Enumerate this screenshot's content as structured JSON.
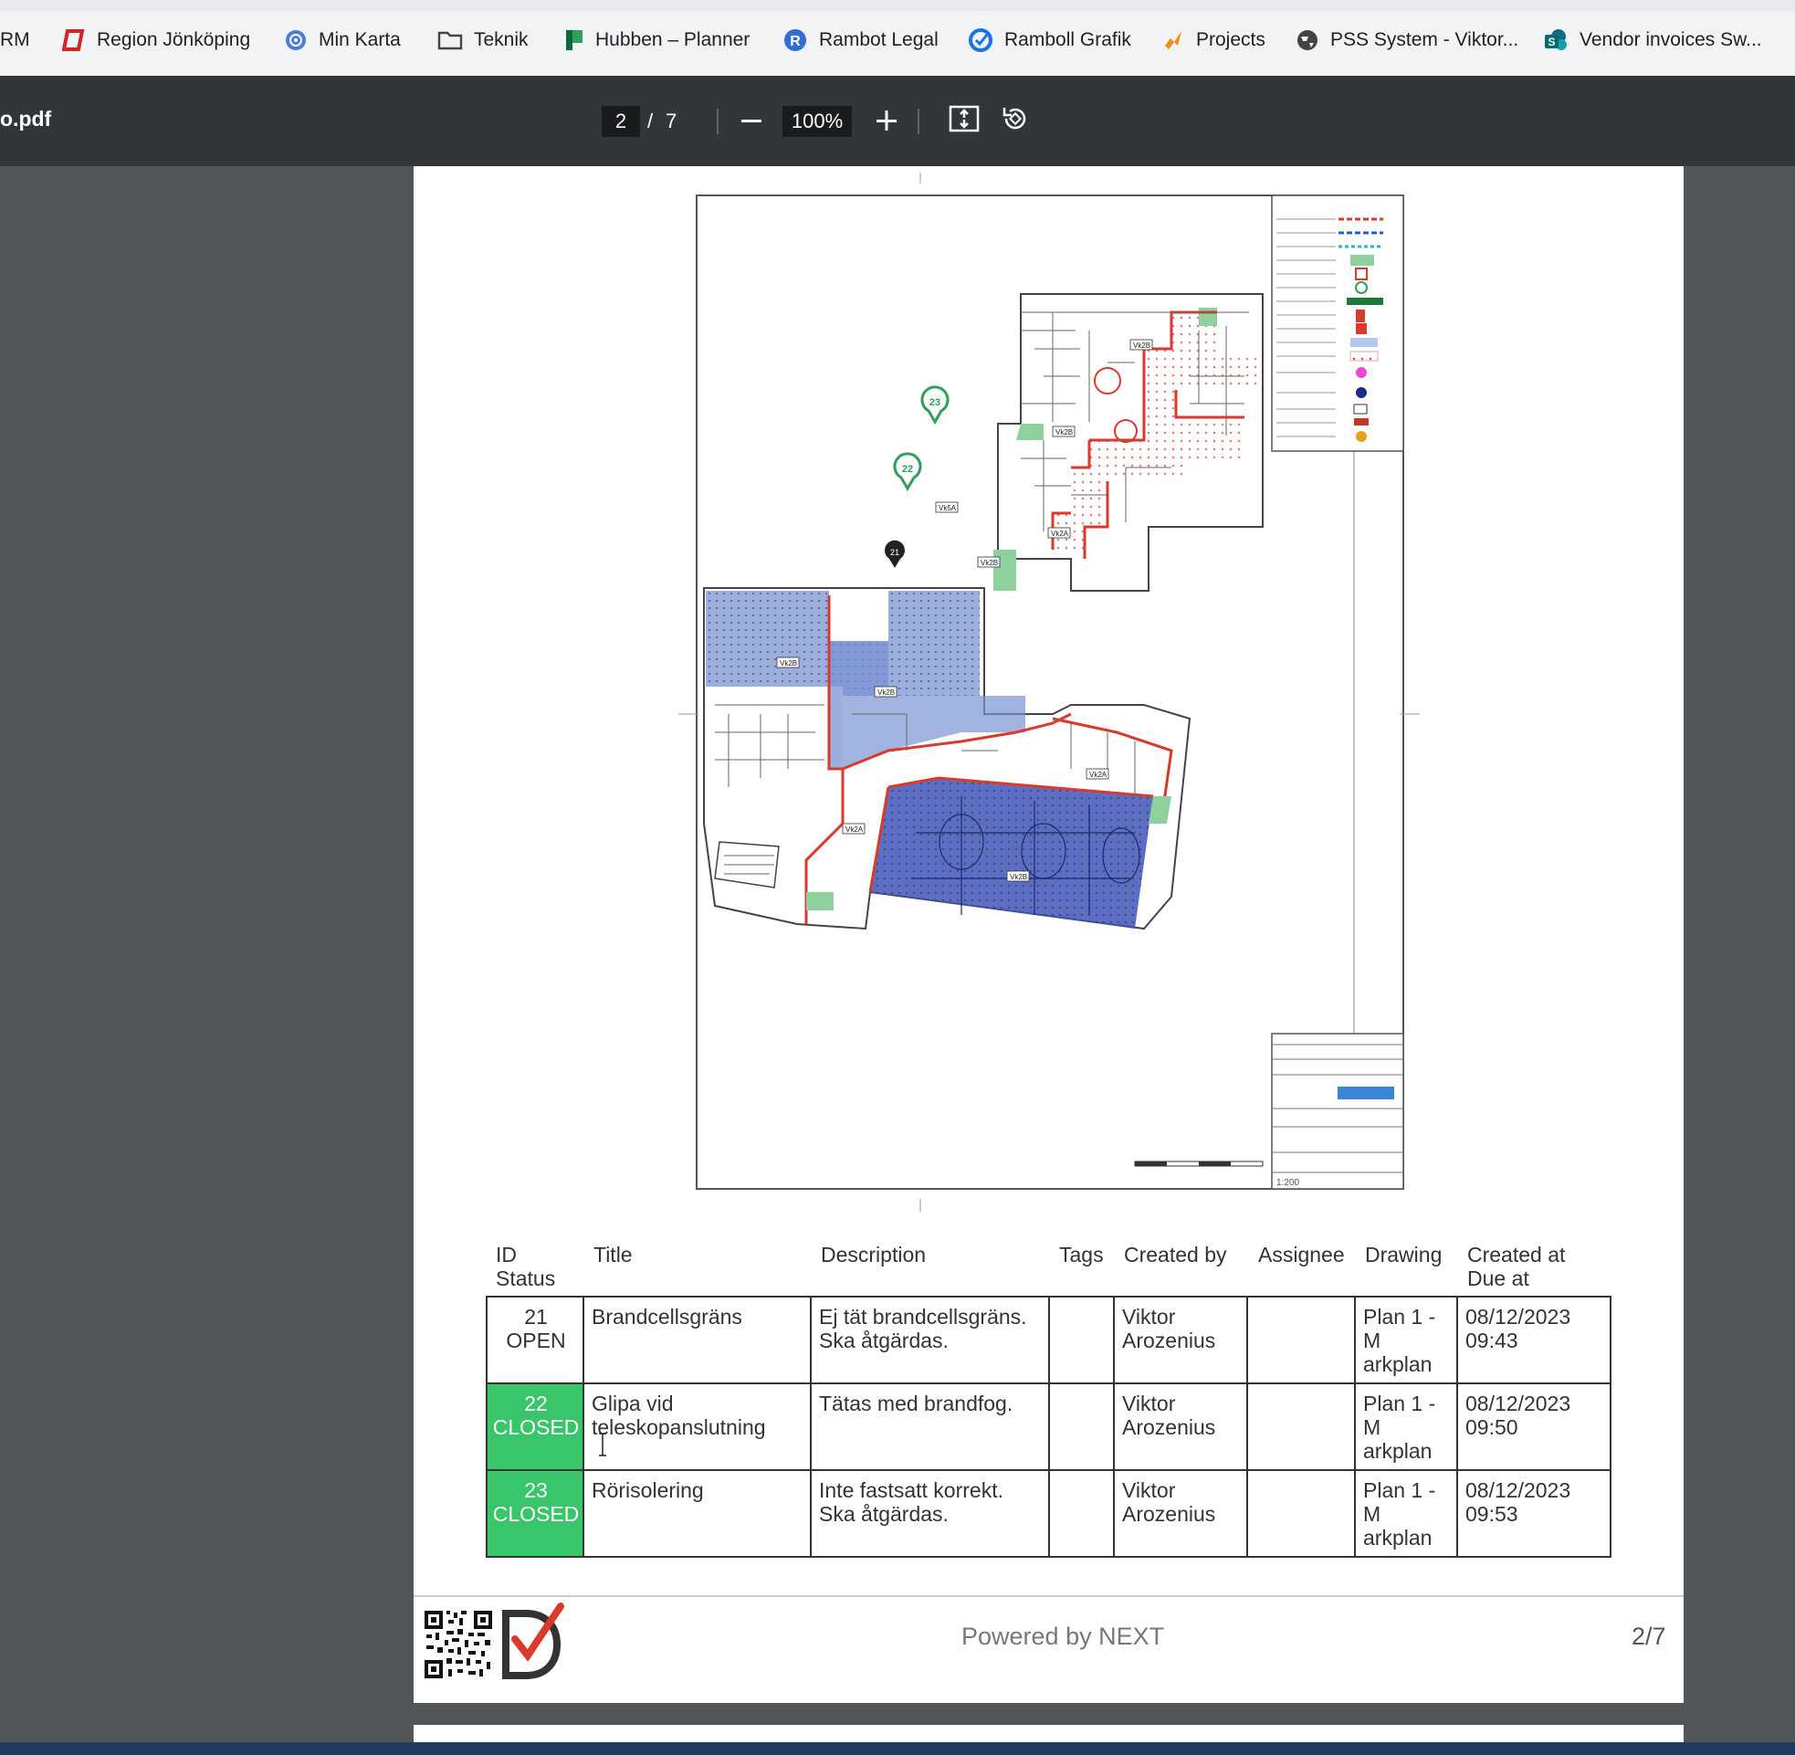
{
  "bookmarks": [
    {
      "label": "RM",
      "icon": "none"
    },
    {
      "label": "Region Jönköping",
      "icon": "region-jonkoping-icon"
    },
    {
      "label": "Min Karta",
      "icon": "map-target-icon"
    },
    {
      "label": "Teknik",
      "icon": "folder-icon"
    },
    {
      "label": "Hubben – Planner",
      "icon": "planner-icon"
    },
    {
      "label": "Rambot Legal",
      "icon": "rambot-icon"
    },
    {
      "label": "Ramboll Grafik",
      "icon": "ramboll-icon"
    },
    {
      "label": "Projects",
      "icon": "projects-icon"
    },
    {
      "label": "PSS System - Viktor...",
      "icon": "globe-icon"
    },
    {
      "label": "Vendor invoices Sw...",
      "icon": "sharepoint-icon"
    }
  ],
  "viewer": {
    "filename": "o.pdf",
    "current_page": "2",
    "separator": "/",
    "total_pages": "7",
    "zoom": "100%"
  },
  "drawing": {
    "markers": [
      "21",
      "22",
      "23"
    ],
    "zone_labels": [
      "Vk2B",
      "Vk2A",
      "Vk5A"
    ],
    "scale": "1:200"
  },
  "table": {
    "headers": {
      "id": "ID",
      "status": "Status",
      "title": "Title",
      "description": "Description",
      "tags": "Tags",
      "created_by": "Created by",
      "assignee": "Assignee",
      "drawing": "Drawing",
      "created_at": "Created at",
      "due_at": "Due at"
    },
    "rows": [
      {
        "id": "21",
        "status": "OPEN",
        "title": "Brandcellsgräns",
        "description_1": "Ej tät brandcellsgräns.",
        "description_2": "Ska åtgärdas.",
        "tags": "",
        "created_by_1": "Viktor",
        "created_by_2": "Arozenius",
        "assignee": "",
        "drawing_1": "Plan 1 -",
        "drawing_2": "M",
        "drawing_3": "arkplan",
        "created_at_1": "08/12/2023",
        "created_at_2": "09:43"
      },
      {
        "id": "22",
        "status": "CLOSED",
        "title_1": "Glipa vid",
        "title_2": "teleskopanslutning",
        "description_1": "Tätas med brandfog.",
        "tags": "",
        "created_by_1": "Viktor",
        "created_by_2": "Arozenius",
        "assignee": "",
        "drawing_1": "Plan 1 -",
        "drawing_2": "M",
        "drawing_3": "arkplan",
        "created_at_1": "08/12/2023",
        "created_at_2": "09:50"
      },
      {
        "id": "23",
        "status": "CLOSED",
        "title": "Rörisolering",
        "description_1": "Inte fastsatt korrekt.",
        "description_2": "Ska åtgärdas.",
        "tags": "",
        "created_by_1": "Viktor",
        "created_by_2": "Arozenius",
        "assignee": "",
        "drawing_1": "Plan 1 -",
        "drawing_2": "M",
        "drawing_3": "arkplan",
        "created_at_1": "08/12/2023",
        "created_at_2": "09:53"
      }
    ]
  },
  "footer": {
    "powered_by": "Powered by NEXT",
    "page_indicator": "2/7"
  },
  "colors": {
    "closed_status": "#39c56a",
    "toolbar": "#323639",
    "viewer_bg": "#525659",
    "fire_line": "#d93a2b",
    "hatch_blue": "#7b93d3"
  }
}
